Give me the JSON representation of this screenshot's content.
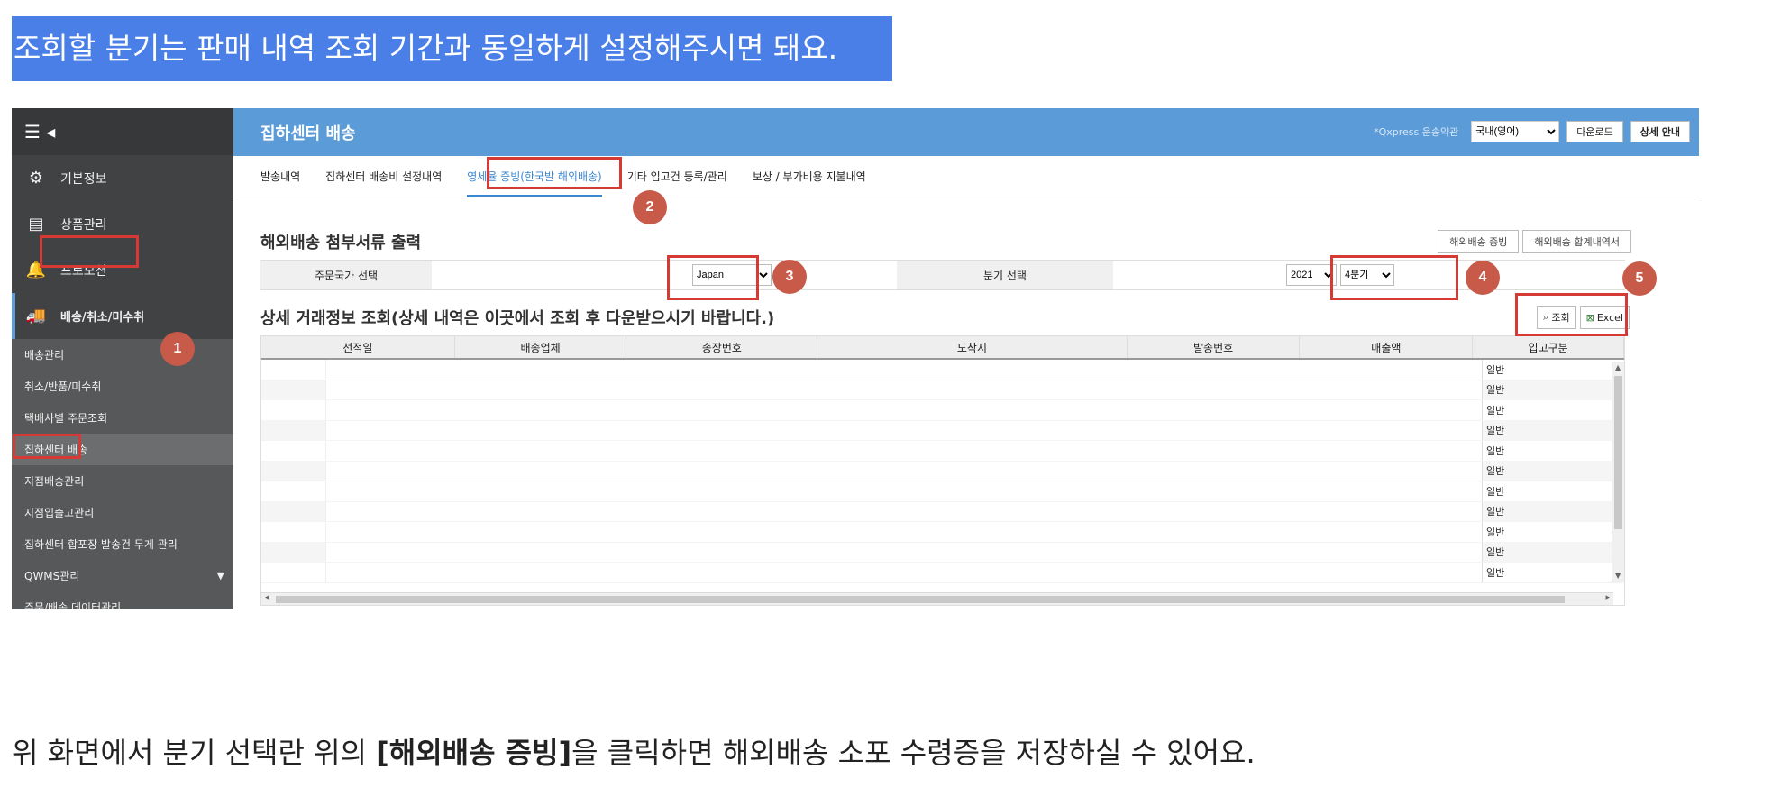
{
  "top_caption": "조회할 분기는 판매 내역 조회 기간과 동일하게 설정해주시면 돼요.",
  "sidebar": {
    "toggle_icon": "list-collapse-icon",
    "menus": [
      {
        "label": "기본정보",
        "icon": "gears-icon"
      },
      {
        "label": "상품관리",
        "icon": "document-icon"
      },
      {
        "label": "프로모션",
        "icon": "bell-icon"
      },
      {
        "label": "배송/취소/미수취",
        "icon": "truck-icon"
      }
    ],
    "sub_items": [
      {
        "label": "배송관리"
      },
      {
        "label": "취소/반품/미수취"
      },
      {
        "label": "택배사별 주문조회"
      },
      {
        "label": "집하센터 배송"
      },
      {
        "label": "지점배송관리"
      },
      {
        "label": "지점입출고관리"
      },
      {
        "label": "집하센터 합포장 발송건 무게 관리"
      },
      {
        "label": "QWMS관리"
      },
      {
        "label": "주문/배송 데이터관리"
      }
    ]
  },
  "header": {
    "title": "집하센터 배송",
    "terms_link": "*Qxpress 운송약관",
    "language_select": "국내(영어)",
    "download_button": "다운로드",
    "guide_button": "상세 안내"
  },
  "tabs": [
    {
      "label": "발송내역"
    },
    {
      "label": "집하센터 배송비 설정내역"
    },
    {
      "label": "영세율 증빙(한국발 해외배송)"
    },
    {
      "label": "기타 입고건 등록/관리"
    },
    {
      "label": "보상 / 부가비용 지불내역"
    }
  ],
  "docs_section": {
    "title": "해외배송 첨부서류 출력",
    "proof_button": "해외배송 증빙",
    "summary_button": "해외배송 합계내역서"
  },
  "filter": {
    "country_label": "주문국가 선택",
    "country_value": "Japan",
    "quarter_label": "분기 선택",
    "year_value": "2021",
    "quarter_value": "4분기"
  },
  "detail_section": {
    "title": "상세 거래정보 조회(상세 내역은 이곳에서 조회 후 다운받으시기 바랍니다.)",
    "search_button": "조회",
    "excel_button": "Excel"
  },
  "grid": {
    "columns": [
      "선적일",
      "배송업체",
      "송장번호",
      "도착지",
      "발송번호",
      "매출액",
      "입고구분"
    ],
    "rows": [
      "일반",
      "일반",
      "일반",
      "일반",
      "일반",
      "일반",
      "일반",
      "일반",
      "일반",
      "일반",
      "일반"
    ]
  },
  "badges": [
    "1",
    "2",
    "3",
    "4",
    "5"
  ],
  "bottom_caption": {
    "prefix": "위 화면에서 분기 선택란 위의 ",
    "bold": "[해외배송 증빙]",
    "suffix": "을 클릭하면 해외배송 소포 수령증을 저장하실 수 있어요."
  },
  "colors": {
    "caption_highlight": "#4a7fe8",
    "header_bar": "#5b9bd8",
    "sidebar_bg": "#404244",
    "annotation_red": "#d63a35",
    "badge": "#c85a4a",
    "active_tab": "#3a86d0"
  }
}
